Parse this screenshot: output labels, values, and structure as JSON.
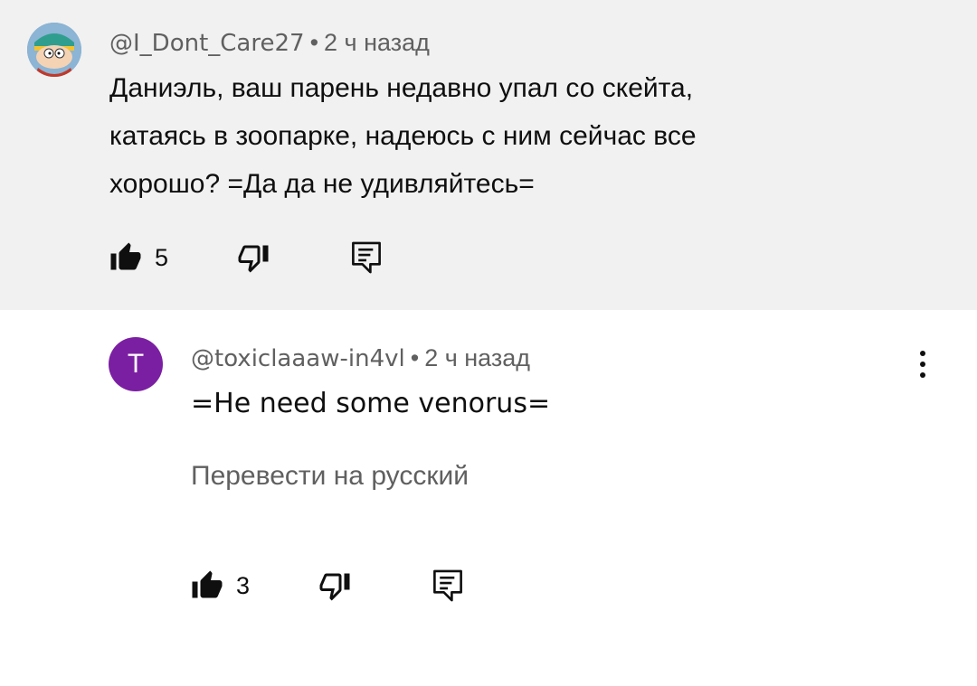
{
  "comment": {
    "author": "@I_Dont_Care27",
    "separator": "•",
    "time": "2 ч назад",
    "lines": [
      "Даниэль, ваш парень недавно упал со скейта,",
      "катаясь в зоопарке, надеюсь с ним сейчас все",
      "хорошо? =Да да не удивляйтесь="
    ],
    "likes": "5"
  },
  "reply": {
    "avatar_letter": "T",
    "author": "@toxiclaaaw-in4vl",
    "separator": "•",
    "time": "2 ч назад",
    "text": "=He need some venorus=",
    "translate_label": "Перевести на русский",
    "likes": "3"
  },
  "icons": {
    "like": "thumbs-up-filled-icon",
    "dislike": "thumbs-down-outline-icon",
    "reply": "reply-comment-icon",
    "more": "more-vert-icon"
  },
  "colors": {
    "comment_bg": "#f1f1f1",
    "reply_avatar": "#7b1fa2",
    "secondary_text": "#606060"
  }
}
